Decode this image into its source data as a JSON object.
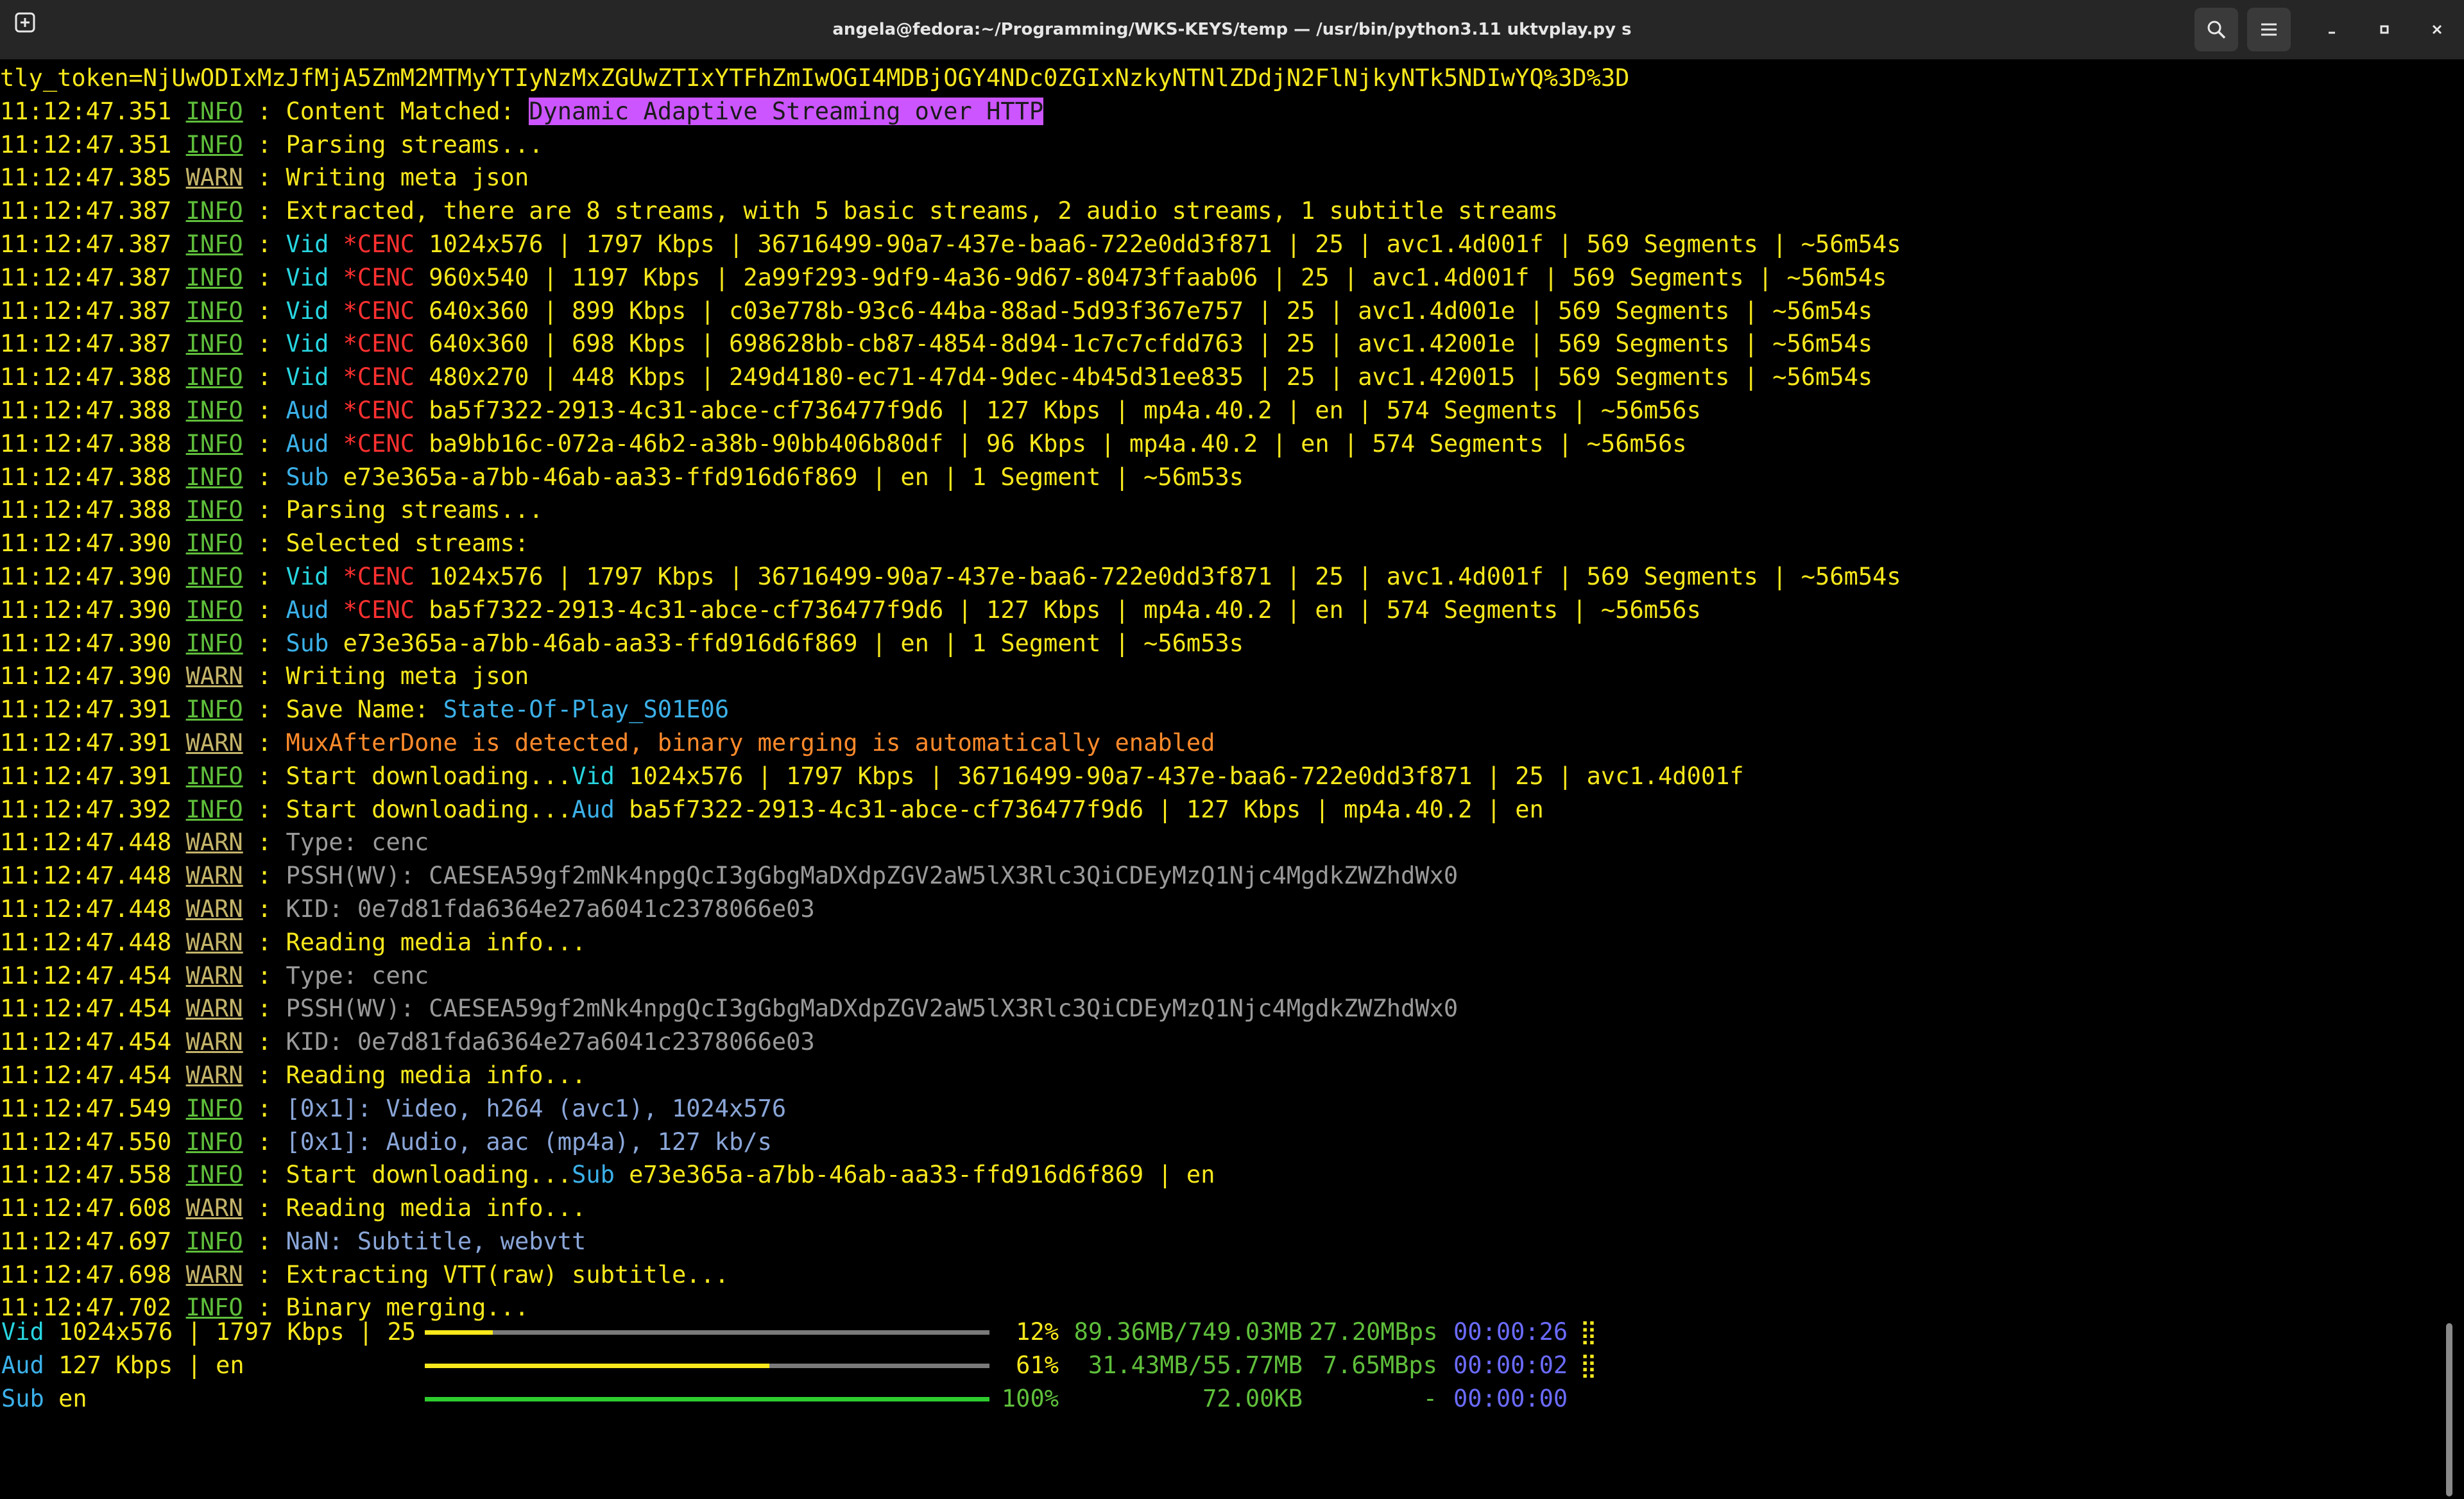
{
  "window": {
    "title": "angela@fedora:~/Programming/WKS-KEYS/temp — /usr/bin/python3.11 uktvplay.py s"
  },
  "colors": {
    "text_yellow": "#f8e81c",
    "info_green": "#5fbf3b",
    "warn_khaki": "#c4b46a",
    "enc_red": "#ff3030",
    "media_cyan": "#3bb0e8",
    "highlight_purple": "#cc55ff",
    "bar_yellow": "#f8e81c",
    "bar_green": "#2ecc2e",
    "eta_blue": "#6b6bff"
  },
  "log": [
    {
      "segs": [
        {
          "t": "tly_token=NjUwODIxMzJfMjA5ZmM2MTMyYTIyNzMxZGUwZTIxYTFhZmIwOGI4MDBjOGY4NDc0ZGIxNzkyNTNlZDdjN2FlNjkyNTk5NDIwYQ%3D%3D"
        }
      ]
    },
    {
      "time": "11:12:47.351",
      "level": "INFO",
      "segs": [
        {
          "t": "Content Matched: "
        },
        {
          "t": "Dynamic Adaptive Streaming over HTTP",
          "c": "hl"
        }
      ]
    },
    {
      "time": "11:12:47.351",
      "level": "INFO",
      "segs": [
        {
          "t": "Parsing streams..."
        }
      ]
    },
    {
      "time": "11:12:47.385",
      "level": "WARN",
      "segs": [
        {
          "t": "Writing meta json"
        }
      ]
    },
    {
      "time": "11:12:47.387",
      "level": "INFO",
      "segs": [
        {
          "t": "Extracted, there are 8 streams, with 5 basic streams, 2 audio streams, 1 subtitle streams"
        }
      ]
    },
    {
      "time": "11:12:47.387",
      "level": "INFO",
      "segs": [
        {
          "t": "Vid ",
          "c": "cyan"
        },
        {
          "t": "*CENC ",
          "c": "red"
        },
        {
          "t": "1024x576 | 1797 Kbps | 36716499-90a7-437e-baa6-722e0dd3f871 | 25 | avc1.4d001f | 569 Segments | ~56m54s"
        }
      ]
    },
    {
      "time": "11:12:47.387",
      "level": "INFO",
      "segs": [
        {
          "t": "Vid ",
          "c": "cyan"
        },
        {
          "t": "*CENC ",
          "c": "red"
        },
        {
          "t": "960x540 | 1197 Kbps | 2a99f293-9df9-4a36-9d67-80473ffaab06 | 25 | avc1.4d001f | 569 Segments | ~56m54s"
        }
      ]
    },
    {
      "time": "11:12:47.387",
      "level": "INFO",
      "segs": [
        {
          "t": "Vid ",
          "c": "cyan"
        },
        {
          "t": "*CENC ",
          "c": "red"
        },
        {
          "t": "640x360 | 899 Kbps | c03e778b-93c6-44ba-88ad-5d93f367e757 | 25 | avc1.4d001e | 569 Segments | ~56m54s"
        }
      ]
    },
    {
      "time": "11:12:47.387",
      "level": "INFO",
      "segs": [
        {
          "t": "Vid ",
          "c": "cyan"
        },
        {
          "t": "*CENC ",
          "c": "red"
        },
        {
          "t": "640x360 | 698 Kbps | 698628bb-cb87-4854-8d94-1c7c7cfdd763 | 25 | avc1.42001e | 569 Segments | ~56m54s"
        }
      ]
    },
    {
      "time": "11:12:47.388",
      "level": "INFO",
      "segs": [
        {
          "t": "Vid ",
          "c": "cyan"
        },
        {
          "t": "*CENC ",
          "c": "red"
        },
        {
          "t": "480x270 | 448 Kbps | 249d4180-ec71-47d4-9dec-4b45d31ee835 | 25 | avc1.420015 | 569 Segments | ~56m54s"
        }
      ]
    },
    {
      "time": "11:12:47.388",
      "level": "INFO",
      "segs": [
        {
          "t": "Aud ",
          "c": "cy"
        },
        {
          "t": "*CENC ",
          "c": "red"
        },
        {
          "t": "ba5f7322-2913-4c31-abce-cf736477f9d6 | 127 Kbps | mp4a.40.2 | en | 574 Segments | ~56m56s"
        }
      ]
    },
    {
      "time": "11:12:47.388",
      "level": "INFO",
      "segs": [
        {
          "t": "Aud ",
          "c": "cy"
        },
        {
          "t": "*CENC ",
          "c": "red"
        },
        {
          "t": "ba9bb16c-072a-46b2-a38b-90bb406b80df | 96 Kbps | mp4a.40.2 | en | 574 Segments | ~56m56s"
        }
      ]
    },
    {
      "time": "11:12:47.388",
      "level": "INFO",
      "segs": [
        {
          "t": "Sub ",
          "c": "cy"
        },
        {
          "t": "e73e365a-a7bb-46ab-aa33-ffd916d6f869 | en | 1 Segment | ~56m53s"
        }
      ]
    },
    {
      "time": "11:12:47.388",
      "level": "INFO",
      "segs": [
        {
          "t": "Parsing streams..."
        }
      ]
    },
    {
      "time": "11:12:47.390",
      "level": "INFO",
      "segs": [
        {
          "t": "Selected streams:"
        }
      ]
    },
    {
      "time": "11:12:47.390",
      "level": "INFO",
      "segs": [
        {
          "t": "Vid ",
          "c": "cyan"
        },
        {
          "t": "*CENC ",
          "c": "red"
        },
        {
          "t": "1024x576 | 1797 Kbps | 36716499-90a7-437e-baa6-722e0dd3f871 | 25 | avc1.4d001f | 569 Segments | ~56m54s"
        }
      ]
    },
    {
      "time": "11:12:47.390",
      "level": "INFO",
      "segs": [
        {
          "t": "Aud ",
          "c": "cy"
        },
        {
          "t": "*CENC ",
          "c": "red"
        },
        {
          "t": "ba5f7322-2913-4c31-abce-cf736477f9d6 | 127 Kbps | mp4a.40.2 | en | 574 Segments | ~56m56s"
        }
      ]
    },
    {
      "time": "11:12:47.390",
      "level": "INFO",
      "segs": [
        {
          "t": "Sub ",
          "c": "cy"
        },
        {
          "t": "e73e365a-a7bb-46ab-aa33-ffd916d6f869 | en | 1 Segment | ~56m53s"
        }
      ]
    },
    {
      "time": "11:12:47.390",
      "level": "WARN",
      "segs": [
        {
          "t": "Writing meta json"
        }
      ]
    },
    {
      "time": "11:12:47.391",
      "level": "INFO",
      "segs": [
        {
          "t": "Save Name: "
        },
        {
          "t": "State-Of-Play_S01E06",
          "c": "cy"
        }
      ]
    },
    {
      "time": "11:12:47.391",
      "level": "WARN",
      "segs": [
        {
          "t": "MuxAfterDone is detected, binary merging is automatically enabled",
          "c": "or"
        }
      ]
    },
    {
      "time": "11:12:47.391",
      "level": "INFO",
      "segs": [
        {
          "t": "Start downloading..."
        },
        {
          "t": "Vid ",
          "c": "cyan"
        },
        {
          "t": "1024x576 | 1797 Kbps | 36716499-90a7-437e-baa6-722e0dd3f871 | 25 | avc1.4d001f"
        }
      ]
    },
    {
      "time": "11:12:47.392",
      "level": "INFO",
      "segs": [
        {
          "t": "Start downloading..."
        },
        {
          "t": "Aud ",
          "c": "cy"
        },
        {
          "t": "ba5f7322-2913-4c31-abce-cf736477f9d6 | 127 Kbps | mp4a.40.2 | en"
        }
      ]
    },
    {
      "time": "11:12:47.448",
      "level": "WARN",
      "segs": [
        {
          "t": "Type: cenc",
          "c": "g"
        }
      ]
    },
    {
      "time": "11:12:47.448",
      "level": "WARN",
      "segs": [
        {
          "t": "PSSH(WV): CAESEA59gf2mNk4npgQcI3gGbgMaDXdpZGV2aW5lX3Rlc3QiCDEyMzQ1Njc4MgdkZWZhdWx0",
          "c": "g"
        }
      ]
    },
    {
      "time": "11:12:47.448",
      "level": "WARN",
      "segs": [
        {
          "t": "KID: 0e7d81fda6364e27a6041c2378066e03",
          "c": "g"
        }
      ]
    },
    {
      "time": "11:12:47.448",
      "level": "WARN",
      "segs": [
        {
          "t": "Reading media info..."
        }
      ]
    },
    {
      "time": "11:12:47.454",
      "level": "WARN",
      "segs": [
        {
          "t": "Type: cenc",
          "c": "g"
        }
      ]
    },
    {
      "time": "11:12:47.454",
      "level": "WARN",
      "segs": [
        {
          "t": "PSSH(WV): CAESEA59gf2mNk4npgQcI3gGbgMaDXdpZGV2aW5lX3Rlc3QiCDEyMzQ1Njc4MgdkZWZhdWx0",
          "c": "g"
        }
      ]
    },
    {
      "time": "11:12:47.454",
      "level": "WARN",
      "segs": [
        {
          "t": "KID: 0e7d81fda6364e27a6041c2378066e03",
          "c": "g"
        }
      ]
    },
    {
      "time": "11:12:47.454",
      "level": "WARN",
      "segs": [
        {
          "t": "Reading media info..."
        }
      ]
    },
    {
      "time": "11:12:47.549",
      "level": "INFO",
      "segs": [
        {
          "t": "[0x1]: Video, h264 (avc1), 1024x576",
          "c": "bl"
        }
      ]
    },
    {
      "time": "11:12:47.550",
      "level": "INFO",
      "segs": [
        {
          "t": "[0x1]: Audio, aac (mp4a), 127 kb/s",
          "c": "bl"
        }
      ]
    },
    {
      "time": "11:12:47.558",
      "level": "INFO",
      "segs": [
        {
          "t": "Start downloading..."
        },
        {
          "t": "Sub ",
          "c": "cy"
        },
        {
          "t": "e73e365a-a7bb-46ab-aa33-ffd916d6f869 | en"
        }
      ]
    },
    {
      "time": "11:12:47.608",
      "level": "WARN",
      "segs": [
        {
          "t": "Reading media info..."
        }
      ]
    },
    {
      "time": "11:12:47.697",
      "level": "INFO",
      "segs": [
        {
          "t": "NaN: Subtitle, webvtt",
          "c": "bl"
        }
      ]
    },
    {
      "time": "11:12:47.698",
      "level": "WARN",
      "segs": [
        {
          "t": "Extracting VTT(raw) subtitle..."
        }
      ]
    },
    {
      "time": "11:12:47.702",
      "level": "INFO",
      "segs": [
        {
          "t": "Binary merging..."
        }
      ]
    }
  ],
  "progress": [
    {
      "kind": "Vid",
      "label": "1024x576 | 1797 Kbps | 25",
      "fraction": 0.12,
      "percent": "12%",
      "size": "89.36MB/749.03MB",
      "speed": "27.20MBps",
      "eta": "00:00:26",
      "spinner": "⣿",
      "bar_color": "#f8e81c"
    },
    {
      "kind": "Aud",
      "label": "127 Kbps | en",
      "fraction": 0.61,
      "percent": "61%",
      "size": "31.43MB/55.77MB",
      "speed": "7.65MBps",
      "eta": "00:00:02",
      "spinner": "⣿",
      "bar_color": "#f8e81c"
    },
    {
      "kind": "Sub",
      "label": "en",
      "fraction": 1.0,
      "percent": "100%",
      "size": "72.00KB",
      "speed": "-",
      "eta": "00:00:00",
      "spinner": "",
      "bar_color": "#2ecc2e"
    }
  ]
}
